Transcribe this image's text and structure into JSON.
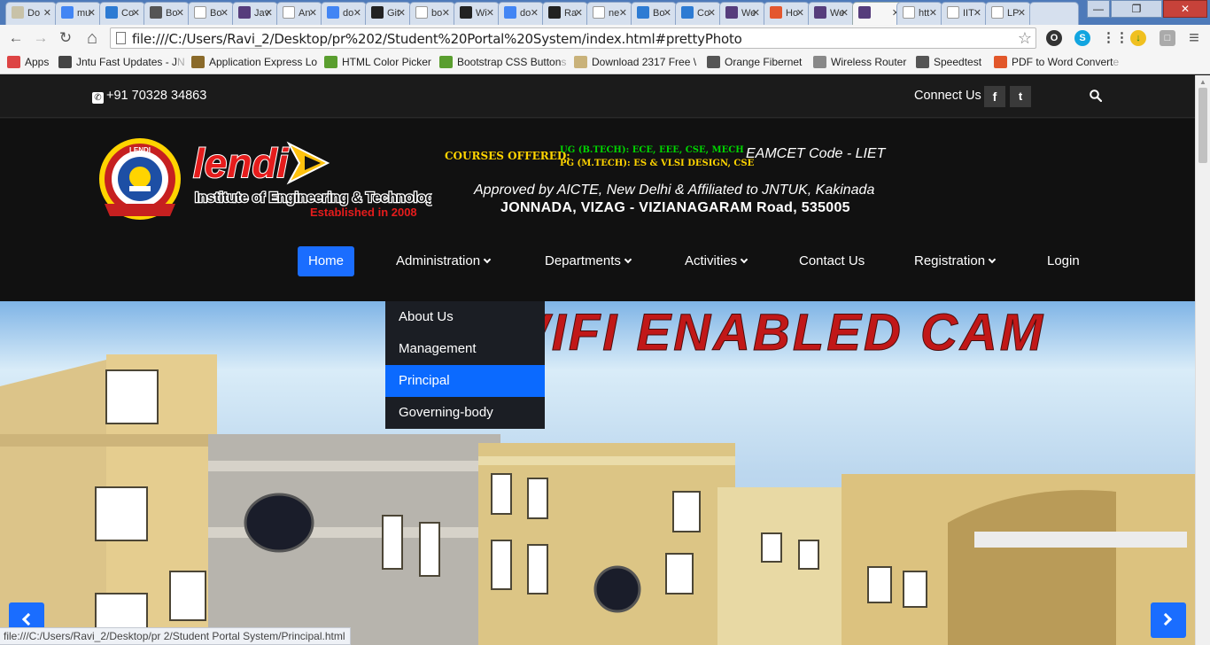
{
  "browser": {
    "tabs": [
      {
        "label": "Do",
        "icon": "doc-icon",
        "color": "#c8c2a8"
      },
      {
        "label": "mu",
        "icon": "google-icon",
        "color": "#4285f4"
      },
      {
        "label": "Co",
        "icon": "bootstrap-b-icon",
        "color": "#2d7bd3"
      },
      {
        "label": "Bo",
        "icon": "bootstrap-b-icon",
        "color": "#555555"
      },
      {
        "label": "Bo",
        "icon": "page-icon",
        "color": "#ffffff"
      },
      {
        "label": "Jav",
        "icon": "bootstrap-b-icon",
        "color": "#563d7c"
      },
      {
        "label": "An",
        "icon": "page-icon",
        "color": "#ffffff"
      },
      {
        "label": "do",
        "icon": "google-icon",
        "color": "#4285f4"
      },
      {
        "label": "Git",
        "icon": "github-icon",
        "color": "#222222"
      },
      {
        "label": "bo",
        "icon": "c-icon",
        "color": "#ffffff"
      },
      {
        "label": "Wi",
        "icon": "github-icon",
        "color": "#222222"
      },
      {
        "label": "do",
        "icon": "google-icon",
        "color": "#4285f4"
      },
      {
        "label": "Ra",
        "icon": "github-icon",
        "color": "#222222"
      },
      {
        "label": "ne",
        "icon": "page-icon",
        "color": "#ffffff"
      },
      {
        "label": "Bo",
        "icon": "bootstrap-b-icon",
        "color": "#2d7bd3"
      },
      {
        "label": "Co",
        "icon": "bootstrap-b-icon",
        "color": "#2d7bd3"
      },
      {
        "label": "We",
        "icon": "bootstrap-b-icon",
        "color": "#563d7c"
      },
      {
        "label": "Ho",
        "icon": "joomla-icon",
        "color": "#e4572e"
      },
      {
        "label": "We",
        "icon": "bootstrap-b-icon",
        "color": "#563d7c"
      },
      {
        "label": "",
        "icon": "bootstrap-b-icon",
        "color": "#563d7c",
        "active": true
      },
      {
        "label": "htt",
        "icon": "orange-c-icon",
        "color": "#ffffff"
      },
      {
        "label": "IIT",
        "icon": "iit-icon",
        "color": "#ffffff"
      },
      {
        "label": "LP",
        "icon": "lpu-icon",
        "color": "#ffffff"
      },
      {
        "label": "",
        "icon": "",
        "color": "#d6e0ee"
      }
    ],
    "tab_close_glyph": "✕",
    "window_buttons": {
      "minimize": "—",
      "maximize": "❐",
      "close": "✕"
    },
    "url": "file:///C:/Users/Ravi_2/Desktop/pr%202/Student%20Portal%20System/index.html#prettyPhoto",
    "nav_glyphs": {
      "back": "←",
      "forward": "→",
      "reload": "↻",
      "home": "⌂",
      "star": "☆",
      "menu": "≡"
    },
    "bookmarks": [
      {
        "label": "Apps",
        "icon": "apps-grid-icon"
      },
      {
        "label": "Jntu Fast Updates - J",
        "fade": "N",
        "icon": "graduation-cap-icon"
      },
      {
        "label": "Application Express Lo",
        "fade": "",
        "icon": "apex-icon"
      },
      {
        "label": "HTML Color Picker",
        "fade": "",
        "icon": "w3-icon"
      },
      {
        "label": "Bootstrap CSS Button",
        "fade": "s",
        "icon": "w3-icon"
      },
      {
        "label": "Download 2317 Free \\",
        "fade": "",
        "icon": "folder-icon"
      },
      {
        "label": "Orange Fibernet",
        "fade": "",
        "icon": "orange-c-icon"
      },
      {
        "label": "Wireless Router",
        "fade": "",
        "icon": "page-icon"
      },
      {
        "label": "Speedtest",
        "fade": "",
        "icon": "speedometer-icon"
      },
      {
        "label": "PDF to Word Convert",
        "fade": "e",
        "icon": "pdf-icon"
      }
    ]
  },
  "site": {
    "phone": "+91 70328 34863",
    "connect_label": "Connect Us",
    "social": {
      "facebook": "f",
      "twitter": "t"
    },
    "logo": {
      "brand": "lendi",
      "subtitle": "Institute of Engineering & Technology",
      "established": "Established in 2008",
      "seal_text": "LENDI"
    },
    "courses": {
      "label": "COURSES OFFERED:",
      "ug": "UG (B.TECH): ECE, EEE, CSE, MECH",
      "pg": "PG (M.TECH): ES & VLSI DESIGN, CSE"
    },
    "eamcet": "EAMCET Code - LIET",
    "approved": "Approved by AICTE, New Delhi & Affiliated to JNTUK, Kakinada",
    "address": "JONNADA, VIZAG - VIZIANAGARAM Road, 535005",
    "nav": {
      "home": "Home",
      "administration": "Administration",
      "departments": "Departments",
      "activities": "Activities",
      "contact": "Contact Us",
      "registration": "Registration",
      "login": "Login"
    },
    "dropdown": [
      {
        "label": "About Us",
        "active": false
      },
      {
        "label": "Management",
        "active": false
      },
      {
        "label": "Principal",
        "active": true
      },
      {
        "label": "Governing-body",
        "active": false
      }
    ],
    "slider": {
      "banner": "WIFI ENABLED CAM"
    },
    "status_url": "file:///C:/Users/Ravi_2/Desktop/pr 2/Student Portal System/Principal.html",
    "colors": {
      "accent": "#1a6dff",
      "dropdown_active": "#0b6aff",
      "header_bg": "#111111"
    }
  }
}
